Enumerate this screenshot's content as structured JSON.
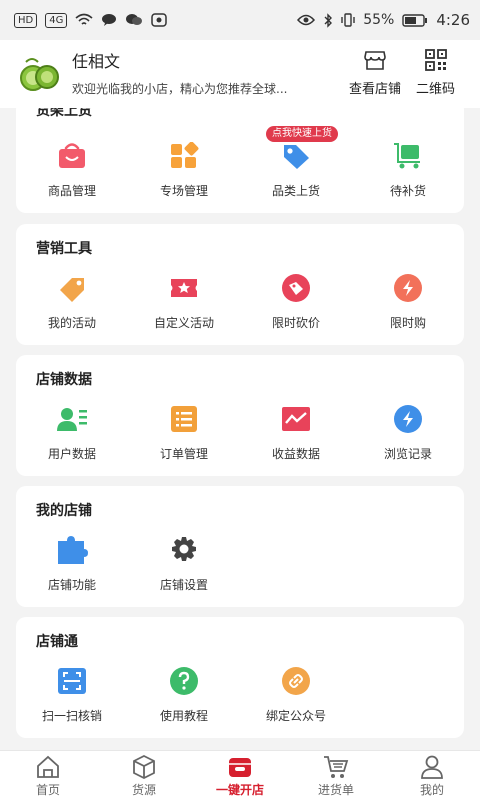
{
  "status_bar": {
    "left_chips": [
      "HD",
      "4G"
    ],
    "battery": "55%",
    "time": "4:26"
  },
  "header": {
    "shop_name": "任相文",
    "shop_desc": "欢迎光临我的小店，精心为您推荐全球...",
    "store_label": "查看店铺",
    "qr_label": "二维码"
  },
  "sections": [
    {
      "title": "货架上货",
      "badge": "点我快速上货",
      "items": [
        {
          "label": "商品管理",
          "icon": "shopping-bag-icon",
          "color": "#f25a6b"
        },
        {
          "label": "专场管理",
          "icon": "grid-icon",
          "color": "#f7a23a"
        },
        {
          "label": "品类上货",
          "icon": "tag-icon",
          "color": "#3f8fe8"
        },
        {
          "label": "待补货",
          "icon": "cart-icon",
          "color": "#3dbb6a"
        }
      ]
    },
    {
      "title": "营销工具",
      "items": [
        {
          "label": "我的活动",
          "icon": "activity-tag-icon",
          "color": "#f2a54a"
        },
        {
          "label": "自定义活动",
          "icon": "ticket-star-icon",
          "color": "#e8435a"
        },
        {
          "label": "限时砍价",
          "icon": "discount-icon",
          "color": "#e8435a"
        },
        {
          "label": "限时购",
          "icon": "flash-icon",
          "color": "#f2715a"
        }
      ]
    },
    {
      "title": "店铺数据",
      "items": [
        {
          "label": "用户数据",
          "icon": "user-card-icon",
          "color": "#3dbb6a"
        },
        {
          "label": "订单管理",
          "icon": "order-list-icon",
          "color": "#f2a03a"
        },
        {
          "label": "收益数据",
          "icon": "chart-icon",
          "color": "#e8435a"
        },
        {
          "label": "浏览记录",
          "icon": "lightning-circle-icon",
          "color": "#3f8fe8"
        }
      ]
    },
    {
      "title": "我的店铺",
      "items": [
        {
          "label": "店铺功能",
          "icon": "puzzle-icon",
          "color": "#3f8fe8"
        },
        {
          "label": "店铺设置",
          "icon": "gear-icon",
          "color": "#444444"
        }
      ]
    },
    {
      "title": "店铺通",
      "items": [
        {
          "label": "扫一扫核销",
          "icon": "scan-icon",
          "color": "#3f8fe8"
        },
        {
          "label": "使用教程",
          "icon": "help-icon",
          "color": "#3dbb6a"
        },
        {
          "label": "绑定公众号",
          "icon": "link-icon",
          "color": "#f2a54a"
        }
      ]
    }
  ],
  "tabbar": {
    "items": [
      {
        "label": "首页",
        "icon": "home-icon"
      },
      {
        "label": "货源",
        "icon": "box-icon"
      },
      {
        "label": "一键开店",
        "icon": "open-store-icon"
      },
      {
        "label": "进货单",
        "icon": "purchase-cart-icon"
      },
      {
        "label": "我的",
        "icon": "profile-icon"
      }
    ],
    "active_index": 2,
    "accent": "#d6202f"
  }
}
